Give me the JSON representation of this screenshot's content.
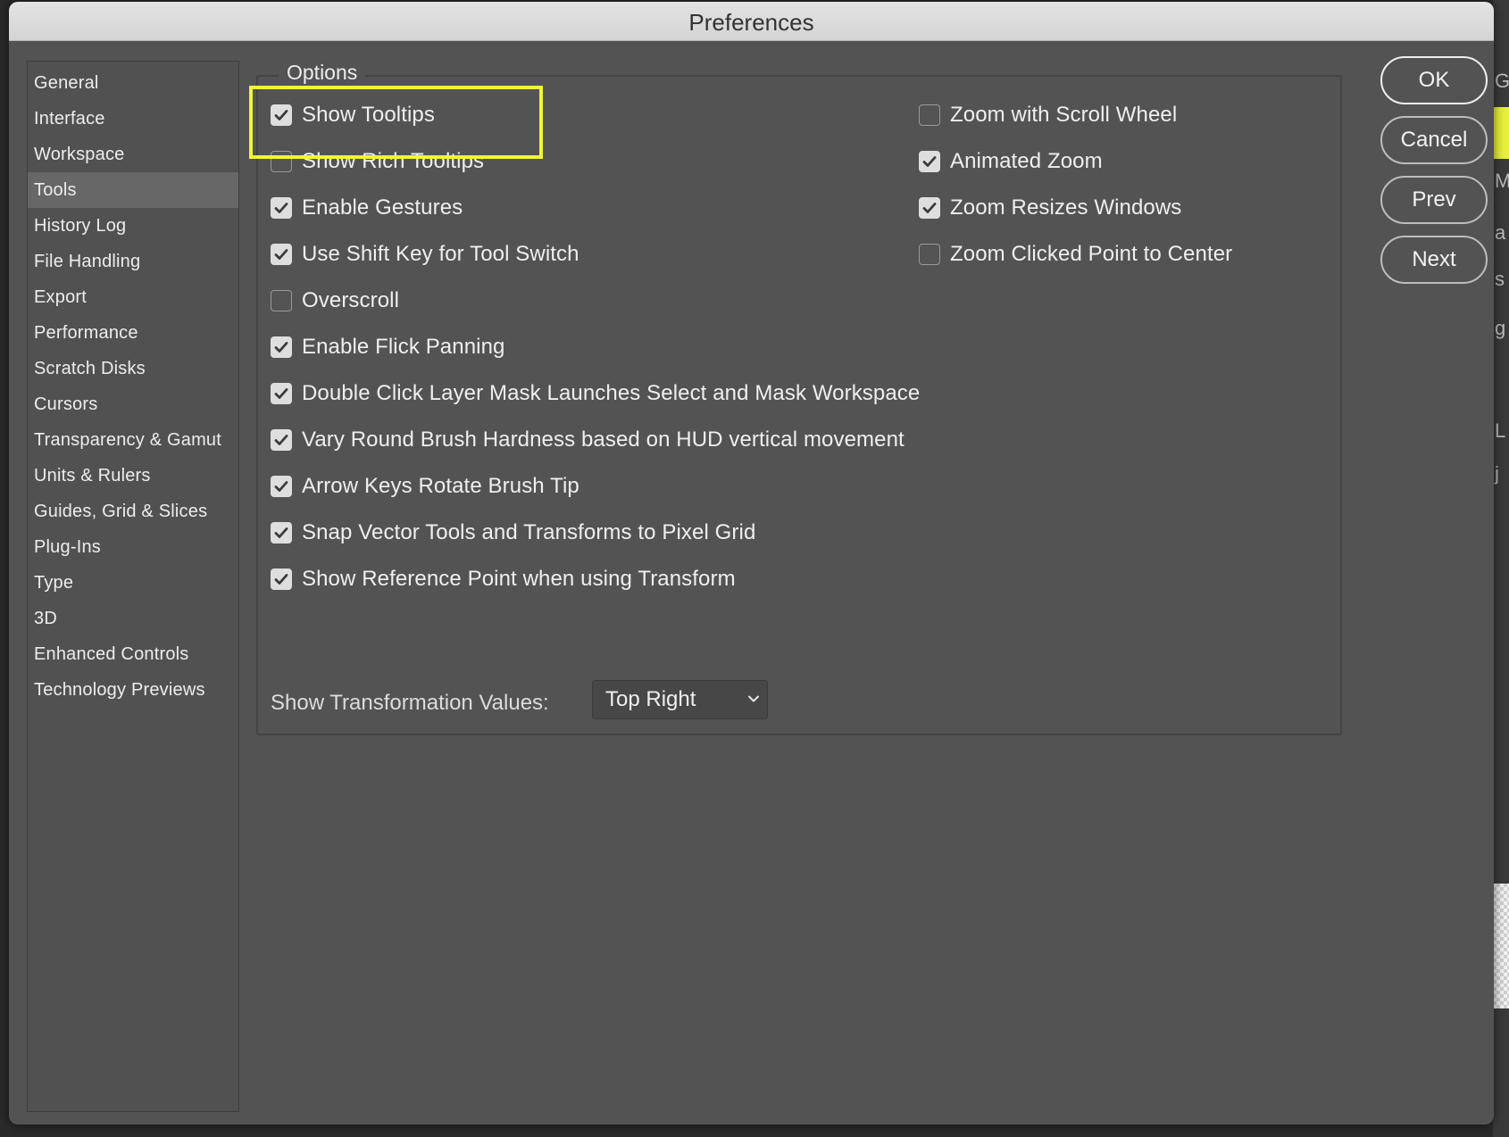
{
  "window": {
    "title": "Preferences"
  },
  "sidebar": {
    "items": [
      {
        "label": "General"
      },
      {
        "label": "Interface"
      },
      {
        "label": "Workspace"
      },
      {
        "label": "Tools",
        "selected": true
      },
      {
        "label": "History Log"
      },
      {
        "label": "File Handling"
      },
      {
        "label": "Export"
      },
      {
        "label": "Performance"
      },
      {
        "label": "Scratch Disks"
      },
      {
        "label": "Cursors"
      },
      {
        "label": "Transparency & Gamut"
      },
      {
        "label": "Units & Rulers"
      },
      {
        "label": "Guides, Grid & Slices"
      },
      {
        "label": "Plug-Ins"
      },
      {
        "label": "Type"
      },
      {
        "label": "3D"
      },
      {
        "label": "Enhanced Controls"
      },
      {
        "label": "Technology Previews"
      }
    ]
  },
  "options": {
    "group_label": "Options",
    "left": [
      {
        "label": "Show Tooltips",
        "checked": true
      },
      {
        "label": "Show Rich Tooltips",
        "checked": false
      },
      {
        "label": "Enable Gestures",
        "checked": true
      },
      {
        "label": "Use Shift Key for Tool Switch",
        "checked": true
      },
      {
        "label": "Overscroll",
        "checked": false
      },
      {
        "label": "Enable Flick Panning",
        "checked": true
      },
      {
        "label": "Double Click Layer Mask Launches Select and Mask Workspace",
        "checked": true
      },
      {
        "label": "Vary Round Brush Hardness based on HUD vertical movement",
        "checked": true
      },
      {
        "label": "Arrow Keys Rotate Brush Tip",
        "checked": true
      },
      {
        "label": "Snap Vector Tools and Transforms to Pixel Grid",
        "checked": true
      },
      {
        "label": "Show Reference Point when using Transform",
        "checked": true
      }
    ],
    "right": [
      {
        "label": "Zoom with Scroll Wheel",
        "checked": false
      },
      {
        "label": "Animated Zoom",
        "checked": true
      },
      {
        "label": "Zoom Resizes Windows",
        "checked": true
      },
      {
        "label": "Zoom Clicked Point to Center",
        "checked": false
      }
    ],
    "transformation": {
      "label": "Show Transformation Values:",
      "value": "Top Right"
    }
  },
  "buttons": {
    "ok": "OK",
    "cancel": "Cancel",
    "prev": "Prev",
    "next": "Next"
  },
  "highlight_color": "#f1f53a"
}
